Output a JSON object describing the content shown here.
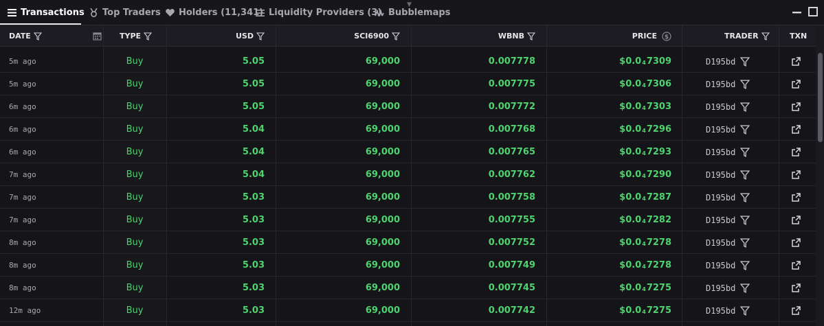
{
  "tabs": [
    {
      "label": "Transactions",
      "icon": "list-icon",
      "active": true
    },
    {
      "label": "Top Traders",
      "icon": "medal-icon"
    },
    {
      "label": "Holders (11,341)",
      "icon": "heart-icon"
    },
    {
      "label": "Liquidity Providers (3)",
      "icon": "lines-icon"
    },
    {
      "label": "Bubblemaps",
      "icon": "bubblemaps-icon"
    }
  ],
  "columns": {
    "date": "DATE",
    "type": "TYPE",
    "usd": "USD",
    "token": "SCI6900",
    "quote": "WBNB",
    "price": "PRICE",
    "trader": "TRADER",
    "txn": "TXN"
  },
  "rows": [
    {
      "date": "5m ago",
      "type": "Buy",
      "usd": "5.05",
      "token": "69,000",
      "quote": "0.007778",
      "price_prefix": "$0.0",
      "price_zeros": "4",
      "price_digits": "7309",
      "trader": "D195bd"
    },
    {
      "date": "5m ago",
      "type": "Buy",
      "usd": "5.05",
      "token": "69,000",
      "quote": "0.007775",
      "price_prefix": "$0.0",
      "price_zeros": "4",
      "price_digits": "7306",
      "trader": "D195bd"
    },
    {
      "date": "6m ago",
      "type": "Buy",
      "usd": "5.05",
      "token": "69,000",
      "quote": "0.007772",
      "price_prefix": "$0.0",
      "price_zeros": "4",
      "price_digits": "7303",
      "trader": "D195bd"
    },
    {
      "date": "6m ago",
      "type": "Buy",
      "usd": "5.04",
      "token": "69,000",
      "quote": "0.007768",
      "price_prefix": "$0.0",
      "price_zeros": "4",
      "price_digits": "7296",
      "trader": "D195bd"
    },
    {
      "date": "6m ago",
      "type": "Buy",
      "usd": "5.04",
      "token": "69,000",
      "quote": "0.007765",
      "price_prefix": "$0.0",
      "price_zeros": "4",
      "price_digits": "7293",
      "trader": "D195bd"
    },
    {
      "date": "7m ago",
      "type": "Buy",
      "usd": "5.04",
      "token": "69,000",
      "quote": "0.007762",
      "price_prefix": "$0.0",
      "price_zeros": "4",
      "price_digits": "7290",
      "trader": "D195bd"
    },
    {
      "date": "7m ago",
      "type": "Buy",
      "usd": "5.03",
      "token": "69,000",
      "quote": "0.007758",
      "price_prefix": "$0.0",
      "price_zeros": "4",
      "price_digits": "7287",
      "trader": "D195bd"
    },
    {
      "date": "7m ago",
      "type": "Buy",
      "usd": "5.03",
      "token": "69,000",
      "quote": "0.007755",
      "price_prefix": "$0.0",
      "price_zeros": "4",
      "price_digits": "7282",
      "trader": "D195bd"
    },
    {
      "date": "8m ago",
      "type": "Buy",
      "usd": "5.03",
      "token": "69,000",
      "quote": "0.007752",
      "price_prefix": "$0.0",
      "price_zeros": "4",
      "price_digits": "7278",
      "trader": "D195bd"
    },
    {
      "date": "8m ago",
      "type": "Buy",
      "usd": "5.03",
      "token": "69,000",
      "quote": "0.007749",
      "price_prefix": "$0.0",
      "price_zeros": "4",
      "price_digits": "7278",
      "trader": "D195bd"
    },
    {
      "date": "8m ago",
      "type": "Buy",
      "usd": "5.03",
      "token": "69,000",
      "quote": "0.007745",
      "price_prefix": "$0.0",
      "price_zeros": "4",
      "price_digits": "7275",
      "trader": "D195bd"
    },
    {
      "date": "12m ago",
      "type": "Buy",
      "usd": "5.03",
      "token": "69,000",
      "quote": "0.007742",
      "price_prefix": "$0.0",
      "price_zeros": "4",
      "price_digits": "7275",
      "trader": "D195bd"
    }
  ],
  "icons": {
    "filter": "filter-icon",
    "calendar": "calendar-icon",
    "currency": "dollar-circle-icon",
    "external": "external-link-icon",
    "minimize": "minimize-icon",
    "maximize": "maximize-icon"
  },
  "colors": {
    "buy": "#4ed36e",
    "background": "#141419",
    "header": "#1c1c22"
  }
}
